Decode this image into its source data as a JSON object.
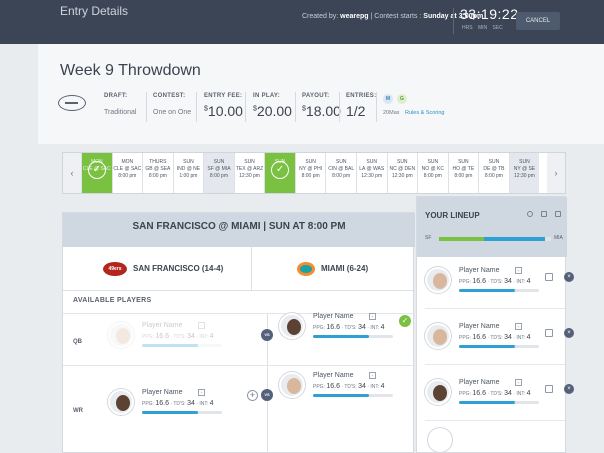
{
  "topbar": {
    "title": "Entry Details",
    "created_prefix": "Created by:",
    "created_user": "wearepg",
    "contest_prefix": "| Contest starts :",
    "contest_time": "Sunday at 3:00pm",
    "clock": "33:19:22",
    "clock_labels": "HRS MIN SEC",
    "cancel": "CANCEL"
  },
  "contest": {
    "title": "Week 9 Throwdown",
    "draft_label": "DRAFT:",
    "draft_value": "Traditional",
    "contest_label": "CONTEST:",
    "contest_value": "One on One",
    "fee_label": "ENTRY FEE:",
    "fee_value": "10.00",
    "inplay_label": "IN PLAY:",
    "inplay_value": "20.00",
    "payout_label": "PAYOUT:",
    "payout_value": "18.00",
    "entries_label": "ENTRIES:",
    "entries_value": "1/2",
    "currency": "$",
    "badge_m": "M",
    "badge_g": "G",
    "entries_max": "20Max",
    "rules_link": "Rules & Scoring"
  },
  "games": {
    "prev": "‹",
    "next": "›",
    "items": [
      {
        "day": "MON",
        "m": "CLE @ SAC",
        "t": ""
      },
      {
        "day": "MON",
        "m": "CLE @ SAC",
        "t": "8:00 pm"
      },
      {
        "day": "THURS",
        "m": "GB @ SEA",
        "t": "8:00 pm"
      },
      {
        "day": "SUN",
        "m": "IND @ NE",
        "t": "1:00 pm"
      },
      {
        "day": "SUN",
        "m": "SF @ MIA",
        "t": "8:00 pm"
      },
      {
        "day": "SUN",
        "m": "TEX @ ARZ",
        "t": "12:30 pm"
      },
      {
        "day": "SUN",
        "m": "",
        "t": ""
      },
      {
        "day": "SUN",
        "m": "NY @ PHI",
        "t": "8:00 pm"
      },
      {
        "day": "SUN",
        "m": "CIN @ BAL",
        "t": "8:00 pm"
      },
      {
        "day": "SUN",
        "m": "LA @ WAS",
        "t": "12:30 pm"
      },
      {
        "day": "SUN",
        "m": "NC @ DEN",
        "t": "12:30 pm"
      },
      {
        "day": "SUN",
        "m": "NO @ KC",
        "t": "8:00 pm"
      },
      {
        "day": "SUN",
        "m": "HO @ TE",
        "t": "8:00 pm"
      },
      {
        "day": "SUN",
        "m": "DE @ TB",
        "t": "8:00 pm"
      },
      {
        "day": "SUN",
        "m": "NY @ SE",
        "t": "12:30 pm"
      }
    ]
  },
  "matchup": {
    "title": "SAN FRANCISCO @ MIAMI | SUN AT 8:00 PM",
    "home_team": "SAN FRANCISCO (14-4)",
    "away_team": "MIAMI (6-24)",
    "logo_sf": "49ers",
    "available": "AVAILABLE PLAYERS",
    "pos_qb": "QB",
    "pos_wr": "WR",
    "vs": "VS"
  },
  "player": {
    "name": "Player Name",
    "ppg_label": "PPG:",
    "ppg": "16.6",
    "tds_label": "TD'S:",
    "tds": "34",
    "int_label": "INT:",
    "int": "4",
    "icon": "+"
  },
  "lineup": {
    "title": "YOUR LINEUP",
    "sf": "SF",
    "mia": "MIA",
    "sf_share": 0.4,
    "mia_share": 0.55
  },
  "colors": {
    "accent_green": "#7ac142",
    "accent_blue": "#2fa0d4",
    "topbar": "#3b4556"
  }
}
